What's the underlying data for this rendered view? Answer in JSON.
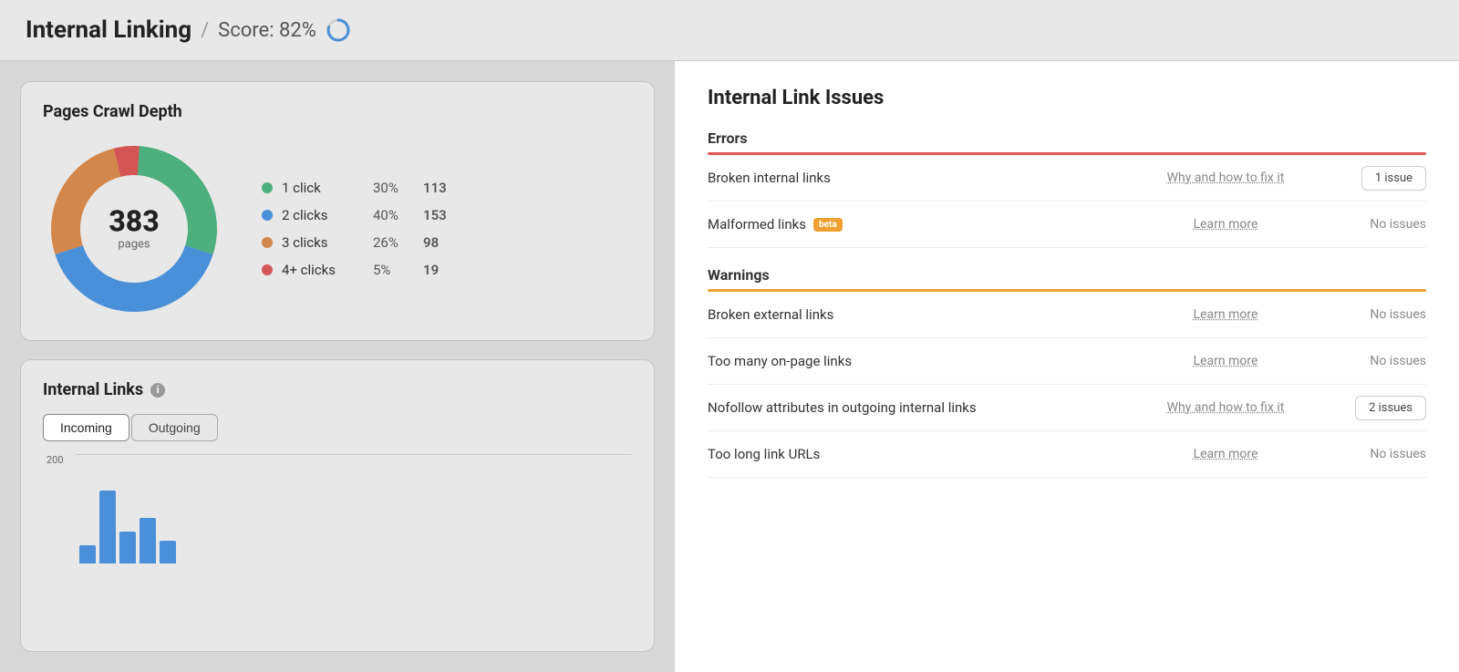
{
  "header": {
    "title": "Internal Linking",
    "divider": "/",
    "score_label": "Score: 82%"
  },
  "crawl_depth": {
    "card_title": "Pages Crawl Depth",
    "total": "383",
    "total_label": "pages",
    "legend": [
      {
        "color": "#4caf7d",
        "name": "1 click",
        "pct": "30%",
        "count": "113"
      },
      {
        "color": "#4a90d9",
        "name": "2 clicks",
        "pct": "40%",
        "count": "153"
      },
      {
        "color": "#d4874a",
        "name": "3 clicks",
        "pct": "26%",
        "count": "98"
      },
      {
        "color": "#d45555",
        "name": "4+ clicks",
        "pct": "5%",
        "count": "19"
      }
    ]
  },
  "internal_links": {
    "card_title": "Internal Links",
    "tabs": [
      "Incoming",
      "Outgoing"
    ],
    "active_tab": "Incoming",
    "chart_y_label": "200"
  },
  "issues": {
    "title": "Internal Link Issues",
    "errors_label": "Errors",
    "warnings_label": "Warnings",
    "error_rows": [
      {
        "name": "Broken internal links",
        "link_text": "Why and how to fix it",
        "status_type": "badge",
        "status": "1 issue",
        "has_beta": false
      },
      {
        "name": "Malformed links",
        "link_text": "Learn more",
        "status_type": "text",
        "status": "No issues",
        "has_beta": true
      }
    ],
    "warning_rows": [
      {
        "name": "Broken external links",
        "link_text": "Learn more",
        "status_type": "text",
        "status": "No issues",
        "has_beta": false
      },
      {
        "name": "Too many on-page links",
        "link_text": "Learn more",
        "status_type": "text",
        "status": "No issues",
        "has_beta": false
      },
      {
        "name": "Nofollow attributes in outgoing internal links",
        "link_text": "Why and how to fix it",
        "status_type": "badge",
        "status": "2 issues",
        "has_beta": false
      },
      {
        "name": "Too long link URLs",
        "link_text": "Learn more",
        "status_type": "text",
        "status": "No issues",
        "has_beta": false
      }
    ]
  }
}
